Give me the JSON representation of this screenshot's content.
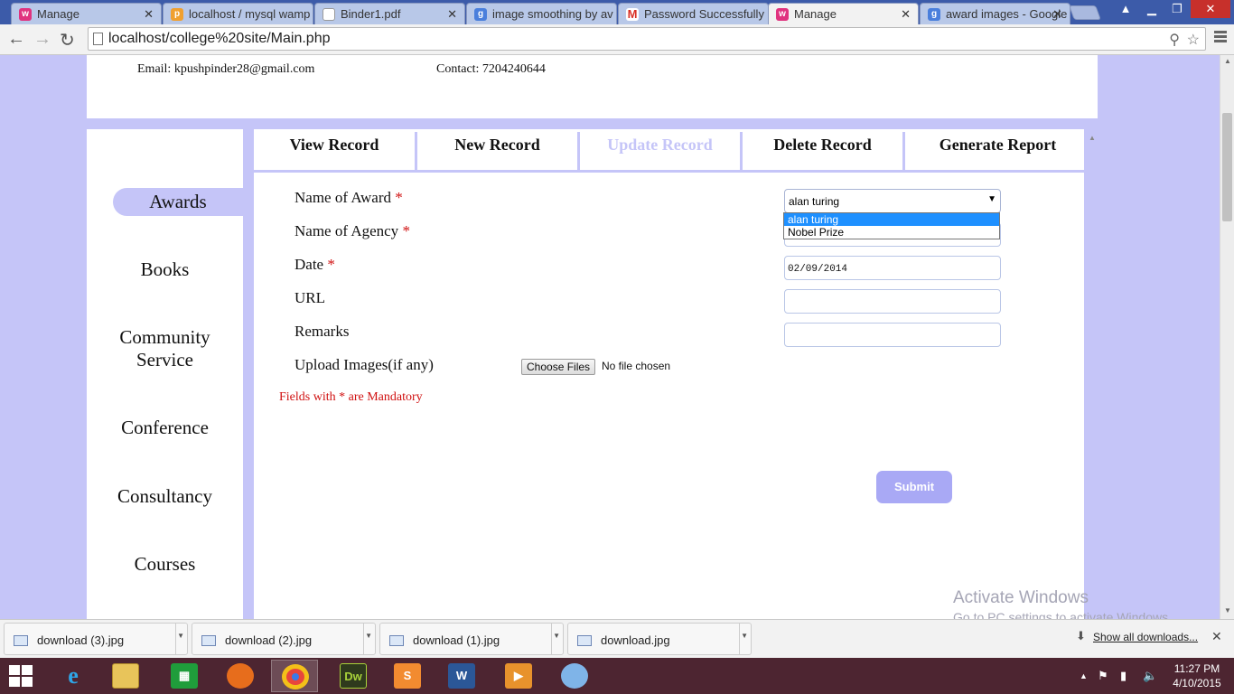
{
  "browser": {
    "tabs": [
      {
        "title": "Manage",
        "favicon": "wamp-icon",
        "color": "#e0337f"
      },
      {
        "title": "localhost / mysql wamp",
        "favicon": "phpmyadmin-icon",
        "color": "#f0a030"
      },
      {
        "title": "Binder1.pdf",
        "favicon": "document-icon",
        "color": "#ffffff"
      },
      {
        "title": "image smoothing by av",
        "favicon": "google-icon",
        "color": "#4a7fdc"
      },
      {
        "title": "Password Successfully",
        "favicon": "gmail-icon",
        "color": "#d93025"
      },
      {
        "title": "Manage",
        "favicon": "wamp-icon",
        "color": "#e0337f"
      },
      {
        "title": "award images - Google",
        "favicon": "google-icon",
        "color": "#4a7fdc"
      }
    ],
    "address": "localhost/college%20site/Main.php"
  },
  "header": {
    "email": "Email: kpushpinder28@gmail.com",
    "contact": "Contact: 7204240644"
  },
  "sidebar": {
    "items": [
      {
        "label": "Awards",
        "active": true
      },
      {
        "label": "Books"
      },
      {
        "label": "Community\nService"
      },
      {
        "label": "Conference"
      },
      {
        "label": "Consultancy"
      },
      {
        "label": "Courses"
      }
    ]
  },
  "tabs": [
    {
      "label": "View Record"
    },
    {
      "label": "New Record"
    },
    {
      "label": "Update Record",
      "disabled": true
    },
    {
      "label": "Delete Record"
    },
    {
      "label": "Generate Report"
    }
  ],
  "form": {
    "award_label": "Name of Award",
    "agency_label": "Name of Agency",
    "date_label": "Date",
    "url_label": "URL",
    "remarks_label": "Remarks",
    "upload_label": "Upload Images(if any)",
    "required_mark": "*",
    "award_value": "alan turing",
    "award_options": [
      "alan turing",
      "Nobel Prize"
    ],
    "date_value": "02/09/2014",
    "url_value": "",
    "remarks_value": "",
    "file_button": "Choose Files",
    "file_status": "No file chosen",
    "mandatory_note": "Fields with * are Mandatory",
    "submit_label": "Submit"
  },
  "watermark": {
    "line1": "Activate Windows",
    "line2": "Go to PC settings to activate Windows."
  },
  "downloads": {
    "items": [
      "download (3).jpg",
      "download (2).jpg",
      "download (1).jpg",
      "download.jpg"
    ],
    "show_all": "Show all downloads..."
  },
  "taskbar": {
    "apps": [
      "internet-explorer-icon",
      "file-explorer-icon",
      "store-icon",
      "firefox-icon",
      "chrome-icon",
      "dreamweaver-icon",
      "sublime-icon",
      "word-icon",
      "media-player-icon",
      "paint-icon"
    ],
    "time": "11:27 PM",
    "date": "4/10/2015"
  },
  "colors": {
    "accent": "#c5c5f8",
    "required": "#d01010",
    "submit": "#a9a9f5",
    "taskbar": "#4d2531"
  }
}
